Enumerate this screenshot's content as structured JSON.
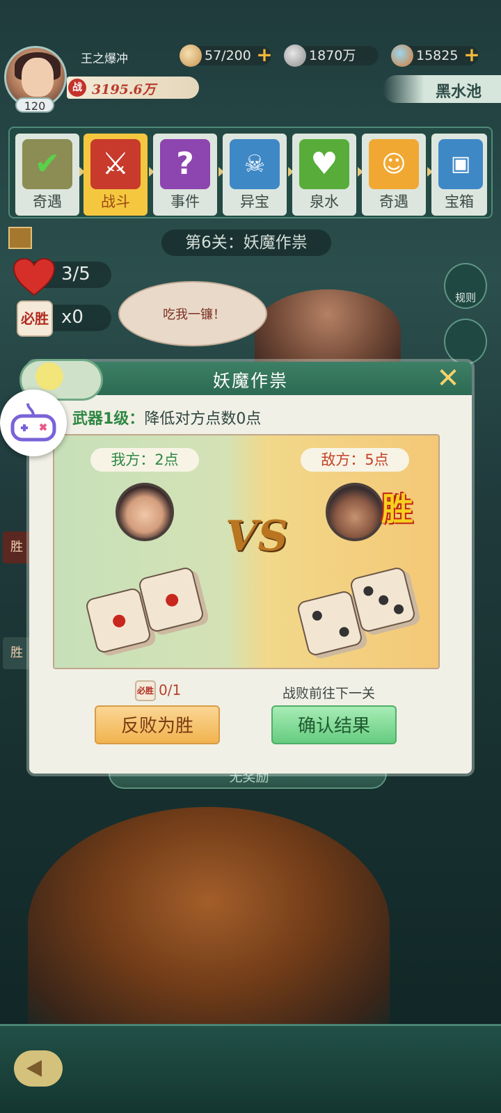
{
  "player": {
    "name": "王之爆冲",
    "level": "120",
    "power_icon": "战",
    "power": "3195.6万"
  },
  "resources": {
    "stamina": "57/200",
    "coins": "1870万",
    "gems": "15825"
  },
  "location": "黑水池",
  "stages": [
    {
      "label": "奇遇",
      "icon": "check-icon",
      "state": "done"
    },
    {
      "label": "战斗",
      "icon": "crossed-swords-icon",
      "state": "active"
    },
    {
      "label": "事件",
      "icon": "question-icon",
      "state": "pending"
    },
    {
      "label": "异宝",
      "icon": "chest-icon",
      "state": "pending"
    },
    {
      "label": "泉水",
      "icon": "heart-icon",
      "state": "pending"
    },
    {
      "label": "奇遇",
      "icon": "mask-icon",
      "state": "pending"
    },
    {
      "label": "宝箱",
      "icon": "treasure-icon",
      "state": "pending"
    }
  ],
  "stage_title": "第6关：妖魔作祟",
  "stats": {
    "hearts": "3/5",
    "win_dice": "x0",
    "win_dice_icon": "必胜"
  },
  "speech": "吃我一镰！",
  "side_buttons": {
    "rules": "规则"
  },
  "background": {
    "tag_win": "胜",
    "reward": "无奖励"
  },
  "modal": {
    "title": "妖魔作祟",
    "weapon_label": "武器1级：",
    "weapon_desc": "降低对方点数0点",
    "me_label": "我方：2点",
    "enemy_label": "敌方：5点",
    "winner_stamp": "胜",
    "vs": "VS",
    "my_dice": [
      1,
      1
    ],
    "enemy_dice": [
      2,
      3
    ],
    "reroll_icon": "必胜",
    "reroll_count": "0/1",
    "defeat_note": "战败前往下一关",
    "btn_reverse": "反败为胜",
    "btn_confirm": "确认结果"
  },
  "colors": {
    "accent_gold": "#f4c73f",
    "header_green": "#2d6a53",
    "enemy_red": "#c44227",
    "ally_green": "#2f8743"
  }
}
